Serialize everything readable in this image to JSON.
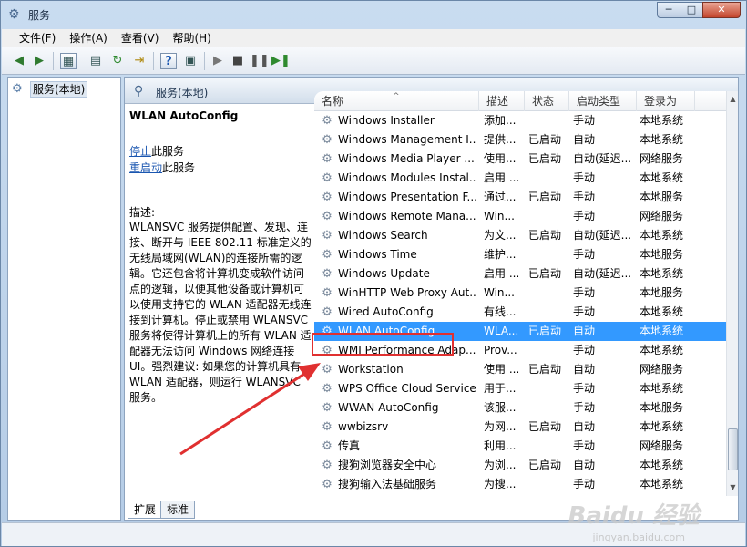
{
  "window": {
    "title": "服务",
    "controls": {
      "minimize": "─",
      "maximize": "□",
      "close": "✕"
    }
  },
  "menu": [
    "文件(F)",
    "操作(A)",
    "查看(V)",
    "帮助(H)"
  ],
  "toolbar": {
    "icons": [
      "back-icon",
      "forward-icon",
      "console-tree-icon",
      "properties-icon",
      "refresh-icon",
      "export-icon",
      "help-icon",
      "view-icon",
      "start-icon",
      "stop-icon",
      "pause-icon",
      "restart-icon"
    ]
  },
  "tree": {
    "item": "服务(本地)"
  },
  "pane": {
    "header": "服务(本地)"
  },
  "detail": {
    "title": "WLAN AutoConfig",
    "stop_link": "停止",
    "stop_suffix": "此服务",
    "restart_link": "重启动",
    "restart_suffix": "此服务",
    "desc_label": "描述:",
    "desc_text": "WLANSVC 服务提供配置、发现、连接、断开与 IEEE 802.11 标准定义的无线局域网(WLAN)的连接所需的逻辑。它还包含将计算机变成软件访问点的逻辑，以便其他设备或计算机可以使用支持它的 WLAN 适配器无线连接到计算机。停止或禁用 WLANSVC 服务将使得计算机上的所有 WLAN 适配器无法访问 Windows 网络连接 UI。强烈建议: 如果您的计算机具有 WLAN 适配器，则运行 WLANSVC 服务。"
  },
  "columns": {
    "name": "名称",
    "desc": "描述",
    "status": "状态",
    "startup": "启动类型",
    "logon": "登录为"
  },
  "services": [
    {
      "name": "Windows Installer",
      "desc": "添加...",
      "status": "",
      "startup": "手动",
      "logon": "本地系统"
    },
    {
      "name": "Windows Management I...",
      "desc": "提供...",
      "status": "已启动",
      "startup": "自动",
      "logon": "本地系统"
    },
    {
      "name": "Windows Media Player ...",
      "desc": "使用...",
      "status": "已启动",
      "startup": "自动(延迟...",
      "logon": "网络服务"
    },
    {
      "name": "Windows Modules Instal...",
      "desc": "启用 ...",
      "status": "",
      "startup": "手动",
      "logon": "本地系统"
    },
    {
      "name": "Windows Presentation F...",
      "desc": "通过...",
      "status": "已启动",
      "startup": "手动",
      "logon": "本地服务"
    },
    {
      "name": "Windows Remote Mana...",
      "desc": "Win...",
      "status": "",
      "startup": "手动",
      "logon": "网络服务"
    },
    {
      "name": "Windows Search",
      "desc": "为文...",
      "status": "已启动",
      "startup": "自动(延迟...",
      "logon": "本地系统"
    },
    {
      "name": "Windows Time",
      "desc": "维护...",
      "status": "",
      "startup": "手动",
      "logon": "本地服务"
    },
    {
      "name": "Windows Update",
      "desc": "启用 ...",
      "status": "已启动",
      "startup": "自动(延迟...",
      "logon": "本地系统"
    },
    {
      "name": "WinHTTP Web Proxy Aut...",
      "desc": "Win...",
      "status": "",
      "startup": "手动",
      "logon": "本地服务"
    },
    {
      "name": "Wired AutoConfig",
      "desc": "有线...",
      "status": "",
      "startup": "手动",
      "logon": "本地系统"
    },
    {
      "name": "WLAN AutoConfig",
      "desc": "WLA...",
      "status": "已启动",
      "startup": "自动",
      "logon": "本地系统"
    },
    {
      "name": "WMI Performance Adap...",
      "desc": "Prov...",
      "status": "",
      "startup": "手动",
      "logon": "本地系统"
    },
    {
      "name": "Workstation",
      "desc": "使用 ...",
      "status": "已启动",
      "startup": "自动",
      "logon": "网络服务"
    },
    {
      "name": "WPS Office Cloud Service",
      "desc": "用于...",
      "status": "",
      "startup": "手动",
      "logon": "本地系统"
    },
    {
      "name": "WWAN AutoConfig",
      "desc": "该服...",
      "status": "",
      "startup": "手动",
      "logon": "本地服务"
    },
    {
      "name": "wwbizsrv",
      "desc": "为网...",
      "status": "已启动",
      "startup": "自动",
      "logon": "本地系统"
    },
    {
      "name": "传真",
      "desc": "利用...",
      "status": "",
      "startup": "手动",
      "logon": "网络服务"
    },
    {
      "name": "搜狗浏览器安全中心",
      "desc": "为浏...",
      "status": "已启动",
      "startup": "自动",
      "logon": "本地系统"
    },
    {
      "name": "搜狗输入法基础服务",
      "desc": "为搜...",
      "status": "",
      "startup": "手动",
      "logon": "本地系统"
    }
  ],
  "selected_service": "WLAN AutoConfig",
  "tabs": [
    "扩展",
    "标准"
  ],
  "watermark": {
    "main": "Baidu 经验",
    "sub": "jingyan.baidu.com"
  },
  "colors": {
    "selection": "#3399ff",
    "highlight_box": "#e03030",
    "arrow": "#e03030",
    "link": "#1a56b0"
  }
}
